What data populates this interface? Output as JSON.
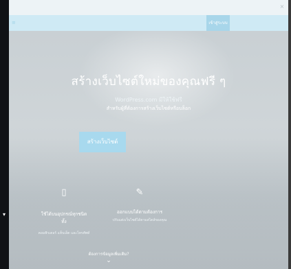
{
  "close_glyph": "×",
  "edge_arrow": "▾",
  "nav": {
    "left_text": "≡",
    "login_label": "เข้าสู่ระบบ"
  },
  "hero": {
    "headline": "สร้างเว็บไซต์ใหม่ของคุณฟรี ๆ",
    "sub1": "WordPress.com มีให้ใช้ฟรี",
    "sub2": "สำหรับผู้ที่ต้องการสร้างเว็บไซต์หรือบล็อก",
    "cta_label": "สร้างเว็บไซต์"
  },
  "features": [
    {
      "icon": "phone-icon",
      "glyph": "▯",
      "title": "ใช้ได้บนอุปกรณ์ทุกชนิด",
      "title2": "ทั้ง",
      "desc": "คอมพิวเตอร์ แท็บเล็ต และโทรศัพท์"
    },
    {
      "icon": "tools-icon",
      "glyph": "✎",
      "title": "ออกแบบได้ตามต้องการ",
      "title2": "",
      "desc": "ปรับแต่งเว็บไซต์ได้ตามสไตล์ของคุณ"
    }
  ],
  "more_label": "ต้องการข้อมูลเพิ่มเติม?",
  "chevron": "⌄",
  "colors": {
    "accent": "#a8d9ee",
    "nav_bg": "#cfeaf5",
    "left_edge": "#101216"
  }
}
